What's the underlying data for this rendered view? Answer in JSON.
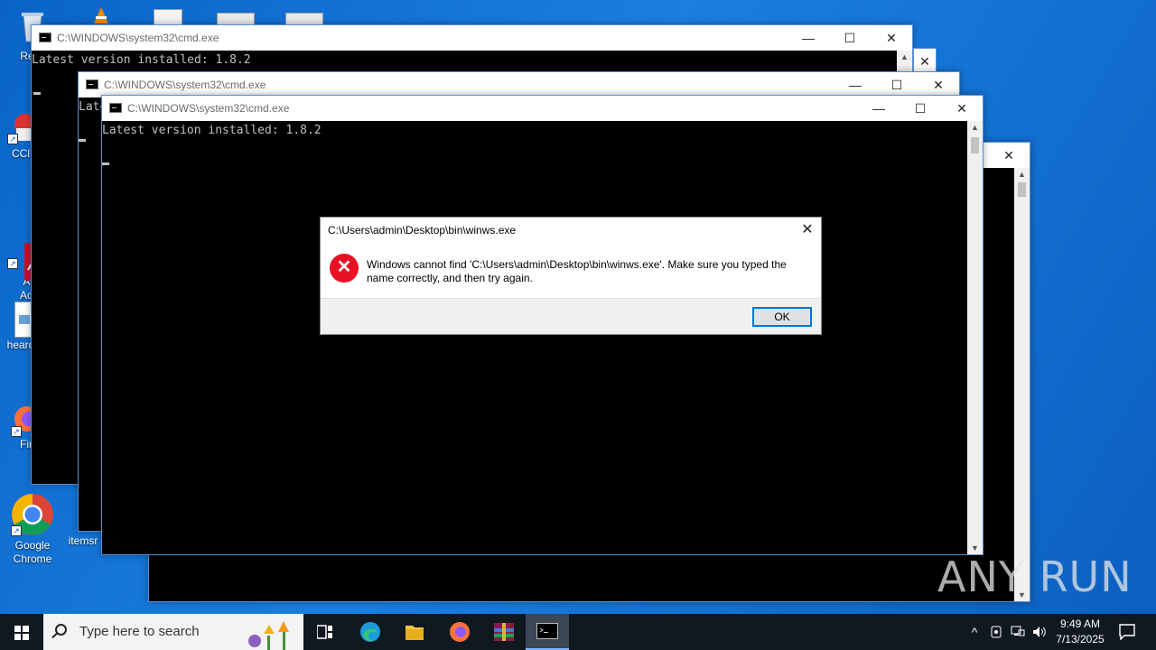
{
  "desktop": {
    "icons": [
      {
        "label": "Recy",
        "icon": "recycle-bin-icon"
      },
      {
        "label": "CCl",
        "icon": "ccleaner-icon"
      },
      {
        "label": "Ad\nAcr",
        "icon": "acrobat-icon"
      },
      {
        "label": "heard",
        "icon": "image-file-icon"
      },
      {
        "label": "Fir",
        "icon": "firefox-icon"
      },
      {
        "label": "Google\nChrome",
        "icon": "chrome-icon"
      },
      {
        "label": "itemsr",
        "icon": "file-icon"
      }
    ]
  },
  "windows": {
    "cmd_back": {
      "title": "C:\\WINDOWS\\system32\\cmd.exe",
      "text": "Latest version installed: 1.8.2"
    },
    "cmd_mid": {
      "title": "C:\\WINDOWS\\system32\\cmd.exe",
      "text": "Late"
    },
    "cmd_front": {
      "title": "C:\\WINDOWS\\system32\\cmd.exe",
      "text": "Latest version installed: 1.8.2"
    },
    "controls": {
      "minimize": "—",
      "maximize": "☐",
      "close": "✕"
    }
  },
  "dialog": {
    "title": "C:\\Users\\admin\\Desktop\\bin\\winws.exe",
    "message": "Windows cannot find 'C:\\Users\\admin\\Desktop\\bin\\winws.exe'. Make sure you typed the name correctly, and then try again.",
    "ok_label": "OK",
    "close_glyph": "✕",
    "error_glyph": "✕"
  },
  "taskbar": {
    "search_placeholder": "Type here to search",
    "pinned": [
      "task-view-icon",
      "edge-icon",
      "file-explorer-icon",
      "firefox-icon",
      "winrar-icon",
      "cmd-icon"
    ],
    "tray_chevron": "^",
    "time": "9:49 AM",
    "date": "7/13/2025"
  },
  "watermark": "ANY RUN",
  "colors": {
    "error_red": "#e81123",
    "accent_blue": "#0078d7",
    "desktop_blue": "#0a64c8"
  }
}
